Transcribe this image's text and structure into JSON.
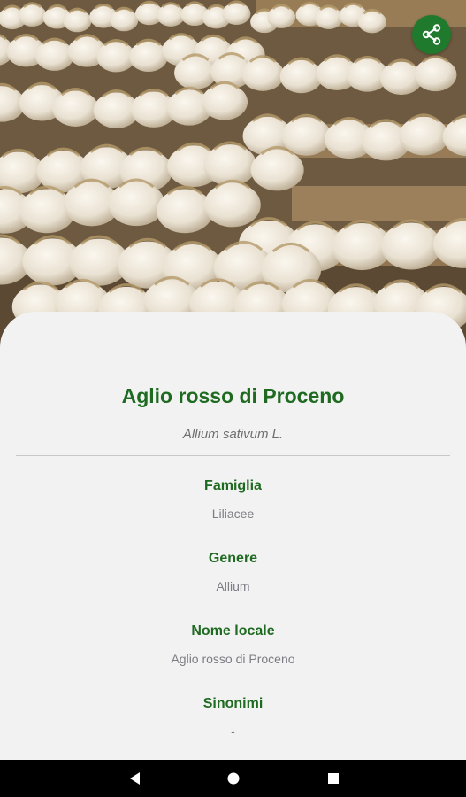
{
  "hero": {
    "image": "garlic-bulbs-photo",
    "share_icon": "share-icon",
    "accent": "#1f7a2e"
  },
  "detail": {
    "title": "Aglio rosso di Proceno",
    "scientific_name": "Allium sativum L.",
    "fields": [
      {
        "label": "Famiglia",
        "value": "Liliacee"
      },
      {
        "label": "Genere",
        "value": "Allium"
      },
      {
        "label": "Nome locale",
        "value": "Aglio rosso di Proceno"
      },
      {
        "label": "Sinonimi",
        "value": "-"
      }
    ],
    "colors": {
      "heading": "#1f6a21",
      "value": "#7c7c84"
    }
  },
  "navbar": {
    "icons": [
      "back-icon",
      "home-icon",
      "recents-icon"
    ]
  }
}
